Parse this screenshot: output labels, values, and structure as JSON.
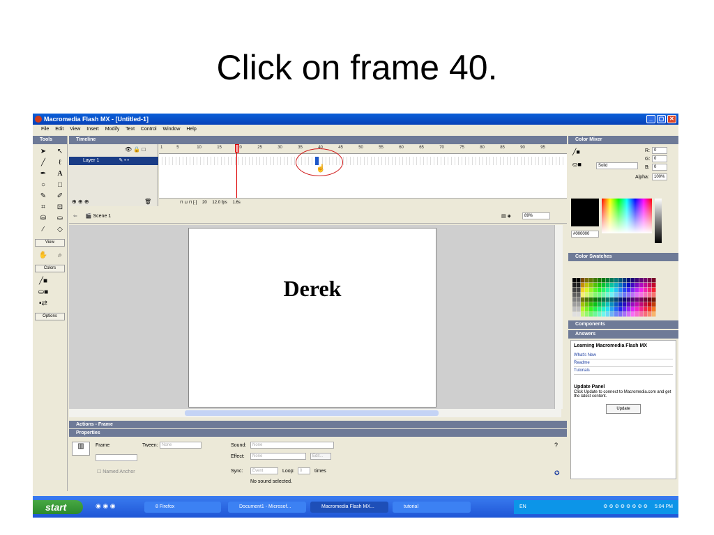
{
  "slide": {
    "title": "Click on frame 40."
  },
  "window": {
    "title": "Macromedia Flash MX - [Untitled-1]"
  },
  "menu": [
    "File",
    "Edit",
    "View",
    "Insert",
    "Modify",
    "Text",
    "Control",
    "Window",
    "Help"
  ],
  "tools": {
    "header": "Tools",
    "view_label": "View",
    "colors_label": "Colors",
    "options_label": "Options"
  },
  "timeline": {
    "header": "Timeline",
    "layer_name": "Layer 1",
    "ruler": [
      "1",
      "5",
      "10",
      "15",
      "20",
      "25",
      "30",
      "35",
      "40",
      "45",
      "50",
      "55",
      "60",
      "65",
      "70",
      "75",
      "80",
      "85",
      "90",
      "95"
    ],
    "current_frame": "20",
    "frame_rate": "12.0 fps",
    "elapsed": "1.6s"
  },
  "scene": {
    "label": "Scene 1",
    "zoom": "89%"
  },
  "stage": {
    "text": "Derek"
  },
  "actions": {
    "header": "Actions - Frame"
  },
  "properties": {
    "header": "Properties",
    "frame_label": "Frame",
    "tween_label": "Tween:",
    "tween_value": "None",
    "sound_label": "Sound:",
    "sound_value": "None",
    "effect_label": "Effect:",
    "effect_value": "None",
    "edit_button": "Edit...",
    "sync_label": "Sync:",
    "sync_value": "Event",
    "loop_label": "Loop:",
    "loop_value": "0",
    "times_label": "times",
    "named_anchor": "Named Anchor",
    "no_sound": "No sound selected."
  },
  "color_mixer": {
    "header": "Color Mixer",
    "fill_type": "Solid",
    "r_label": "R:",
    "r": "0",
    "g_label": "G:",
    "g": "0",
    "b_label": "B:",
    "b": "0",
    "alpha_label": "Alpha:",
    "alpha": "100%",
    "hex": "#000000"
  },
  "swatches": {
    "header": "Color Swatches"
  },
  "components": {
    "header": "Components"
  },
  "answers": {
    "header": "Answers",
    "title": "Learning Macromedia Flash MX",
    "links": [
      "What's New",
      "Readme",
      "Tutorials"
    ],
    "update_title": "Update Panel",
    "update_text": "Click Update to connect to Macromedia.com and get the latest content.",
    "update_button": "Update"
  },
  "taskbar": {
    "start": "start",
    "tasks": [
      "8 Firefox",
      "Document1 - Microsof...",
      "Macromedia Flash MX...",
      "tutorial"
    ],
    "lang": "EN",
    "clock": "5:04 PM"
  },
  "colors": {
    "title_blue": "#0a5fd8",
    "selected_frame": "#1e57c9",
    "highlight_red": "#d01a1a"
  }
}
